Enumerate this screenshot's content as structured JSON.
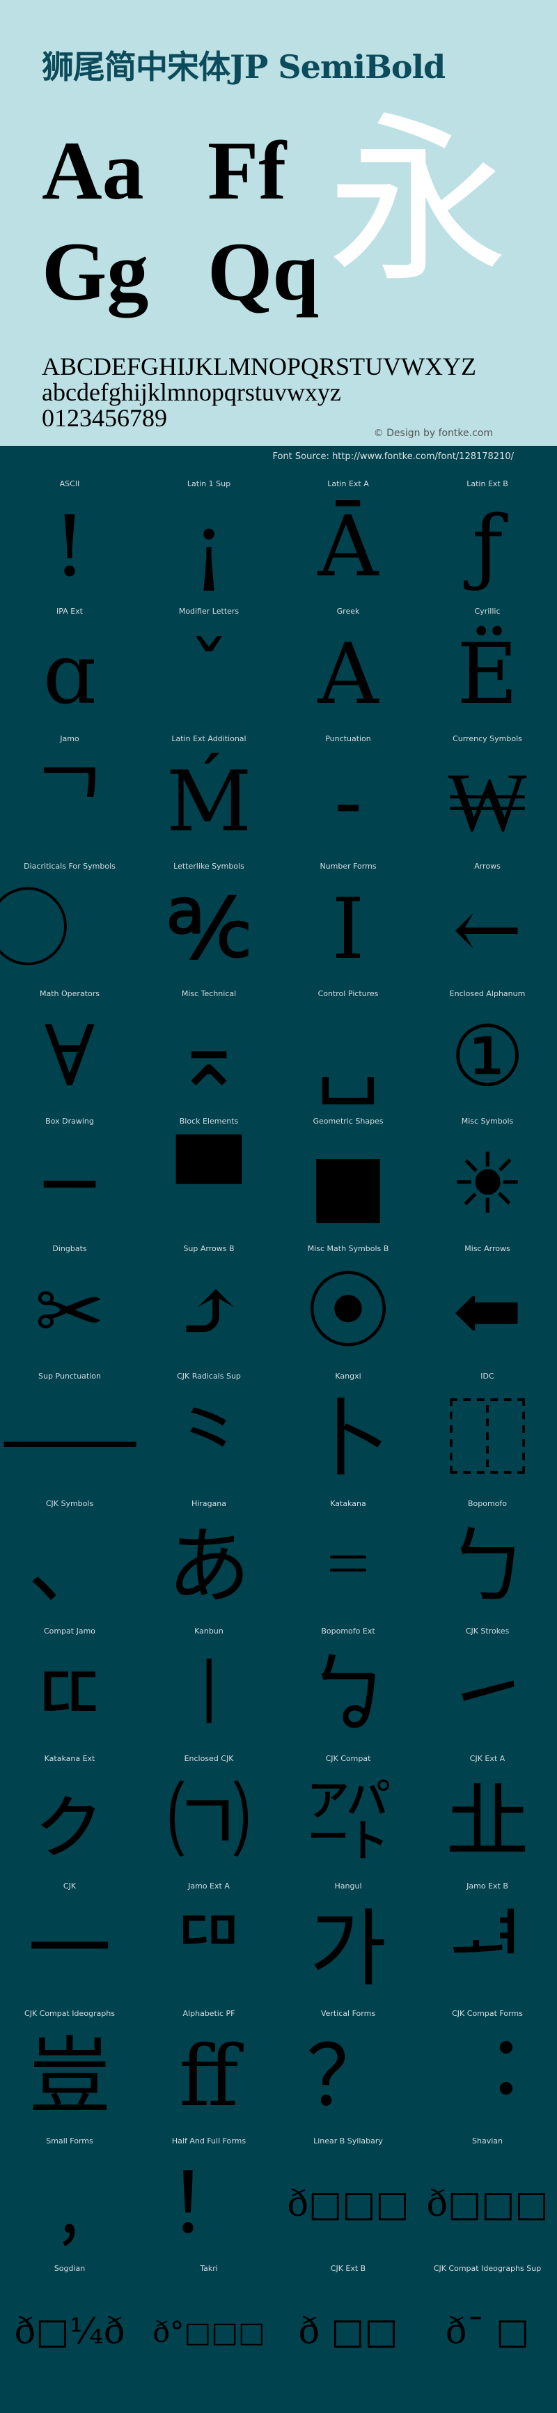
{
  "header": {
    "title": "狮尾简中宋体JP SemiBold",
    "specimen": [
      "Aa",
      "Ff",
      "Gg",
      "Qq"
    ],
    "hero_glyph": "永",
    "uppercase": "ABCDEFGHIJKLMNOPQRSTUVWXYZ",
    "lowercase": "abcdefghijklmnopqrstuvwxyz",
    "digits": "0123456789",
    "credit": "© Design by fontke.com"
  },
  "source": "Font Source: http://www.fontke.com/font/128178210/",
  "colors": {
    "top_bg": "#bce0e3",
    "bottom_bg": "#01424f",
    "title": "#0b4b5b"
  },
  "blocks": [
    {
      "label": "ASCII",
      "glyph": "!"
    },
    {
      "label": "Latin 1 Sup",
      "glyph": "¡"
    },
    {
      "label": "Latin Ext A",
      "glyph": "Ā"
    },
    {
      "label": "Latin Ext B",
      "glyph": "ƒ"
    },
    {
      "label": "IPA Ext",
      "glyph": "ɑ"
    },
    {
      "label": "Modifier Letters",
      "glyph": "ˇ"
    },
    {
      "label": "Greek",
      "glyph": "Α"
    },
    {
      "label": "Cyrillic",
      "glyph": "Ё"
    },
    {
      "label": "Jamo",
      "glyph": "ᄀ"
    },
    {
      "label": "Latin Ext Additional",
      "glyph": "Ḿ"
    },
    {
      "label": "Punctuation",
      "glyph": "‐"
    },
    {
      "label": "Currency Symbols",
      "glyph": "₩"
    },
    {
      "label": "Diacriticals For Symbols",
      "glyph": "⃝"
    },
    {
      "label": "Letterlike Symbols",
      "glyph": "℀"
    },
    {
      "label": "Number Forms",
      "glyph": "Ⅰ"
    },
    {
      "label": "Arrows",
      "glyph": "←"
    },
    {
      "label": "Math Operators",
      "glyph": "∀"
    },
    {
      "label": "Misc Technical",
      "glyph": "⌅"
    },
    {
      "label": "Control Pictures",
      "glyph": "␣"
    },
    {
      "label": "Enclosed Alphanum",
      "glyph": "①"
    },
    {
      "label": "Box Drawing",
      "glyph": "─"
    },
    {
      "label": "Block Elements",
      "glyph": "▀"
    },
    {
      "label": "Geometric Shapes",
      "glyph": "■"
    },
    {
      "label": "Misc Symbols",
      "glyph": "☀"
    },
    {
      "label": "Dingbats",
      "glyph": "✂"
    },
    {
      "label": "Sup Arrows B",
      "glyph": "⤴"
    },
    {
      "label": "Misc Math Symbols B",
      "glyph": "⦿"
    },
    {
      "label": "Misc Arrows",
      "glyph": "⬅"
    },
    {
      "label": "Sup Punctuation",
      "glyph": "⸺"
    },
    {
      "label": "CJK Radicals Sup",
      "glyph": "⺀"
    },
    {
      "label": "Kangxi",
      "glyph": "⼘"
    },
    {
      "label": "IDC",
      "glyph": "⿰"
    },
    {
      "label": "CJK Symbols",
      "glyph": "、"
    },
    {
      "label": "Hiragana",
      "glyph": "あ"
    },
    {
      "label": "Katakana",
      "glyph": "゠"
    },
    {
      "label": "Bopomofo",
      "glyph": "ㄅ"
    },
    {
      "label": "Compat Jamo",
      "glyph": "ㄸ"
    },
    {
      "label": "Kanbun",
      "glyph": "㆐"
    },
    {
      "label": "Bopomofo Ext",
      "glyph": "ㆠ"
    },
    {
      "label": "CJK Strokes",
      "glyph": "㇀"
    },
    {
      "label": "Katakana Ext",
      "glyph": "ㇰ"
    },
    {
      "label": "Enclosed CJK",
      "glyph": "㈀"
    },
    {
      "label": "CJK Compat",
      "glyph": "㌀"
    },
    {
      "label": "CJK Ext A",
      "glyph": "㐀"
    },
    {
      "label": "CJK",
      "glyph": "一"
    },
    {
      "label": "Jamo Ext A",
      "glyph": "ꥠ"
    },
    {
      "label": "Hangul",
      "glyph": "가"
    },
    {
      "label": "Jamo Ext B",
      "glyph": "ힰ"
    },
    {
      "label": "CJK Compat Ideographs",
      "glyph": "豈"
    },
    {
      "label": "Alphabetic PF",
      "glyph": "ﬀ"
    },
    {
      "label": "Vertical Forms",
      "glyph": "？"
    },
    {
      "label": "CJK Compat Forms",
      "glyph": "︓"
    },
    {
      "label": "Small Forms",
      "glyph": "﹐"
    },
    {
      "label": "Half And Full Forms",
      "glyph": "！"
    },
    {
      "label": "Linear B Syllabary",
      "glyph": "ð□□□"
    },
    {
      "label": "Shavian",
      "glyph": "ð□□□"
    },
    {
      "label": "Sogdian",
      "glyph": "ð□¼ð"
    },
    {
      "label": "Takri",
      "glyph": "ð°□□□"
    },
    {
      "label": "CJK Ext B",
      "glyph": "ð □□"
    },
    {
      "label": "CJK Compat Ideographs Sup",
      "glyph": "ð¯ □"
    }
  ]
}
